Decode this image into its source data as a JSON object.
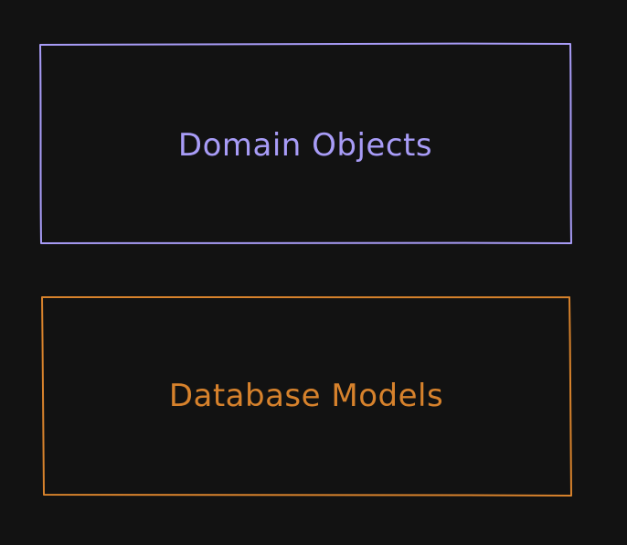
{
  "diagram": {
    "background_color": "#121212",
    "boxes": [
      {
        "id": "domain-objects",
        "label": "Domain Objects",
        "color": "#a89cf7"
      },
      {
        "id": "database-models",
        "label": "Database Models",
        "color": "#d7822c"
      }
    ]
  }
}
